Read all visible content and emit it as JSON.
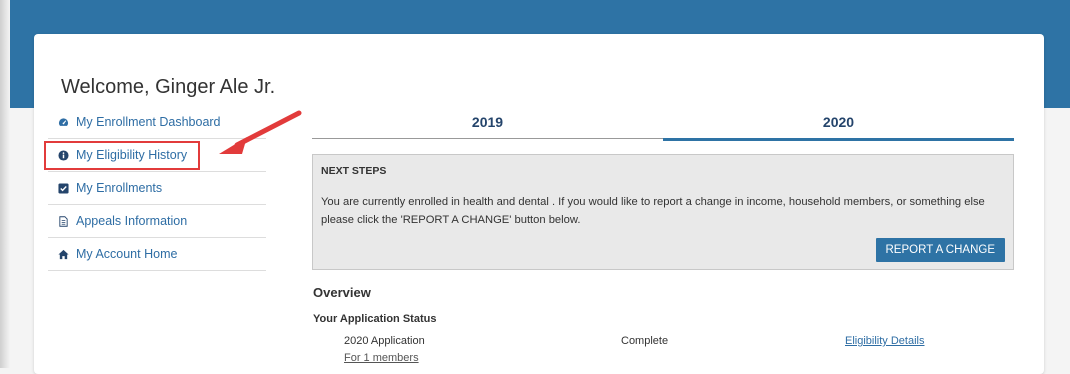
{
  "colors": {
    "header": "#2e73a5",
    "link": "#2e6da4",
    "highlight": "#e23b3b",
    "button": "#2e73a5"
  },
  "welcome": "Welcome, Ginger Ale Jr.",
  "sidebar": {
    "items": [
      {
        "label": "My Enrollment Dashboard",
        "icon": "dashboard-icon"
      },
      {
        "label": "My Eligibility History",
        "icon": "info-circle-icon",
        "highlighted": true
      },
      {
        "label": "My Enrollments",
        "icon": "checkbox-icon"
      },
      {
        "label": "Appeals Information",
        "icon": "document-icon"
      },
      {
        "label": "My Account Home",
        "icon": "home-icon"
      }
    ]
  },
  "tabs": [
    {
      "label": "2019",
      "active": false
    },
    {
      "label": "2020",
      "active": true
    }
  ],
  "next_steps": {
    "title": "NEXT STEPS",
    "text": "You are currently enrolled in health and dental . If you would like to report a change in income, household members, or something else please click the 'REPORT A CHANGE' button below.",
    "button": "REPORT A CHANGE"
  },
  "overview": {
    "title": "Overview",
    "status_heading": "Your Application Status",
    "application": {
      "name": "2020 Application",
      "members": "For 1 members",
      "status": "Complete",
      "details_link": "Eligibility Details"
    }
  }
}
